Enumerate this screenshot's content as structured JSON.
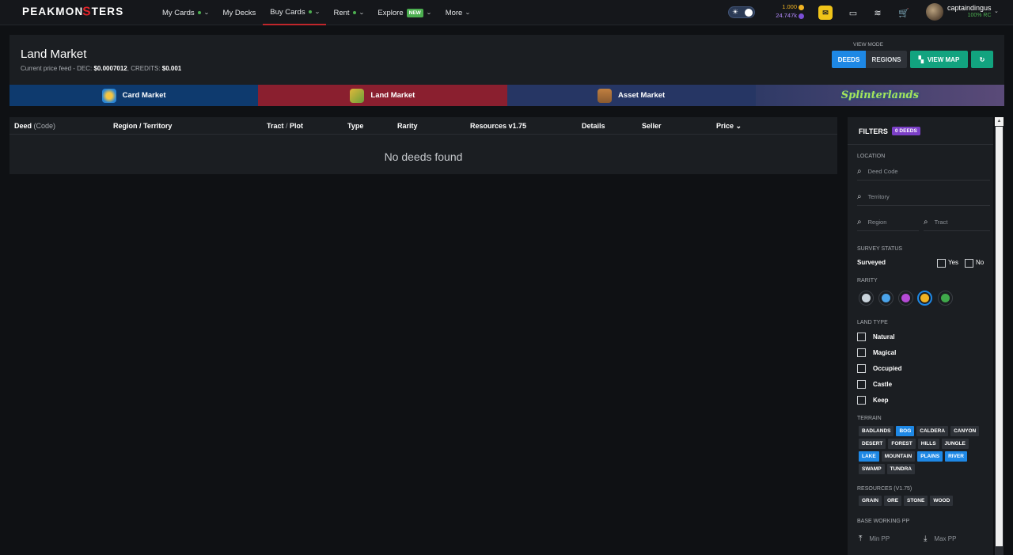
{
  "app": {
    "logo": "PEAKMONSTERS"
  },
  "nav": [
    {
      "label": "My Cards",
      "dot": true,
      "chevron": true
    },
    {
      "label": "My Decks",
      "dot": false,
      "chevron": false
    },
    {
      "label": "Buy Cards",
      "dot": true,
      "chevron": true,
      "active": true
    },
    {
      "label": "Rent",
      "dot": true,
      "chevron": true
    },
    {
      "label": "Explore",
      "badge": "NEW",
      "chevron": true
    },
    {
      "label": "More",
      "chevron": true
    }
  ],
  "balances": {
    "b1": "1.000",
    "b2": "24.747k"
  },
  "user": {
    "name": "captaindingus",
    "rc": "100% RC"
  },
  "header": {
    "title": "Land Market",
    "feed_prefix": "Current price feed - DEC: ",
    "dec": "$0.0007012",
    "feed_mid": ", CREDITS: ",
    "credits": "$0.001",
    "view_mode_label": "VIEW MODE",
    "deeds_btn": "DEEDS",
    "regions_btn": "REGIONS",
    "map_btn": "VIEW MAP"
  },
  "market_tabs": [
    {
      "label": "Card Market"
    },
    {
      "label": "Land Market"
    },
    {
      "label": "Asset Market"
    },
    {
      "label": "Splinterlands"
    }
  ],
  "table": {
    "columns": [
      {
        "main": "Deed",
        "sub": " (Code)"
      },
      {
        "main": "Region / Territory",
        "sub": ""
      },
      {
        "main": "Tract",
        "sub": " / ",
        "main2": "Plot"
      },
      {
        "main": "Type",
        "sub": ""
      },
      {
        "main": "Rarity",
        "sub": ""
      },
      {
        "main": "Resources v1.75",
        "sub": ""
      },
      {
        "main": "Details",
        "sub": ""
      },
      {
        "main": "Seller",
        "sub": ""
      },
      {
        "main": "Price",
        "sub": ""
      }
    ],
    "empty_text": "No deeds found"
  },
  "filters": {
    "title": "FILTERS",
    "badge": "0 DEEDS",
    "location_label": "LOCATION",
    "deed_code_placeholder": "Deed Code",
    "territory_placeholder": "Territory",
    "region_placeholder": "Region",
    "tract_placeholder": "Tract",
    "survey_label": "SURVEY STATUS",
    "surveyed": "Surveyed",
    "yes": "Yes",
    "no": "No",
    "rarity_label": "RARITY",
    "rarity_colors": [
      "#c9d3db",
      "#4aa3ea",
      "#b54ad6",
      "#f0b323",
      "#3fa84a"
    ],
    "land_type_label": "LAND TYPE",
    "land_types": [
      "Natural",
      "Magical",
      "Occupied",
      "Castle",
      "Keep"
    ],
    "terrain_label": "TERRAIN",
    "terrains": [
      {
        "t": "BADLANDS",
        "on": false
      },
      {
        "t": "BOG",
        "on": true
      },
      {
        "t": "CALDERA",
        "on": false
      },
      {
        "t": "CANYON",
        "on": false
      },
      {
        "t": "DESERT",
        "on": false
      },
      {
        "t": "FOREST",
        "on": false
      },
      {
        "t": "HILLS",
        "on": false
      },
      {
        "t": "JUNGLE",
        "on": false
      },
      {
        "t": "LAKE",
        "on": true
      },
      {
        "t": "MOUNTAIN",
        "on": false
      },
      {
        "t": "PLAINS",
        "on": true
      },
      {
        "t": "RIVER",
        "on": true
      },
      {
        "t": "SWAMP",
        "on": false
      },
      {
        "t": "TUNDRA",
        "on": false
      }
    ],
    "resources_label": "RESOURCES (V1.75)",
    "resources": [
      "GRAIN",
      "ORE",
      "STONE",
      "WOOD"
    ],
    "pp_label": "BASE WORKING PP",
    "min_pp": "Min PP",
    "max_pp": "Max PP"
  }
}
